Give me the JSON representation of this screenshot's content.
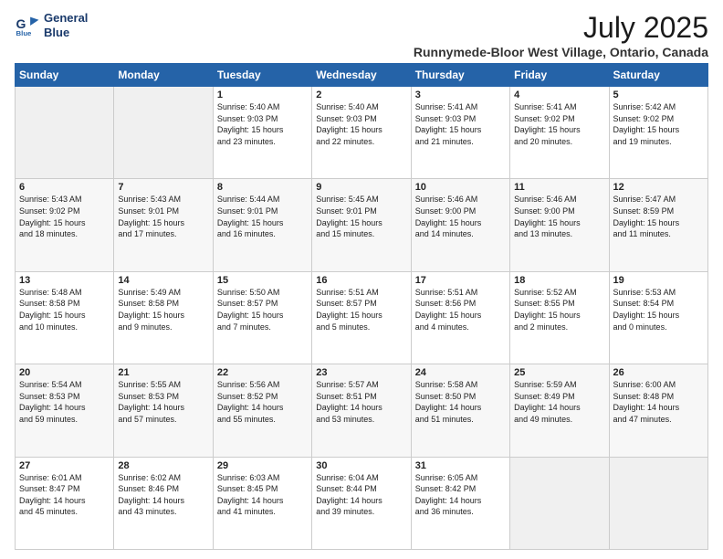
{
  "logo": {
    "line1": "General",
    "line2": "Blue"
  },
  "title": "July 2025",
  "location": "Runnymede-Bloor West Village, Ontario, Canada",
  "headers": [
    "Sunday",
    "Monday",
    "Tuesday",
    "Wednesday",
    "Thursday",
    "Friday",
    "Saturday"
  ],
  "weeks": [
    [
      {
        "day": "",
        "info": ""
      },
      {
        "day": "",
        "info": ""
      },
      {
        "day": "1",
        "info": "Sunrise: 5:40 AM\nSunset: 9:03 PM\nDaylight: 15 hours\nand 23 minutes."
      },
      {
        "day": "2",
        "info": "Sunrise: 5:40 AM\nSunset: 9:03 PM\nDaylight: 15 hours\nand 22 minutes."
      },
      {
        "day": "3",
        "info": "Sunrise: 5:41 AM\nSunset: 9:03 PM\nDaylight: 15 hours\nand 21 minutes."
      },
      {
        "day": "4",
        "info": "Sunrise: 5:41 AM\nSunset: 9:02 PM\nDaylight: 15 hours\nand 20 minutes."
      },
      {
        "day": "5",
        "info": "Sunrise: 5:42 AM\nSunset: 9:02 PM\nDaylight: 15 hours\nand 19 minutes."
      }
    ],
    [
      {
        "day": "6",
        "info": "Sunrise: 5:43 AM\nSunset: 9:02 PM\nDaylight: 15 hours\nand 18 minutes."
      },
      {
        "day": "7",
        "info": "Sunrise: 5:43 AM\nSunset: 9:01 PM\nDaylight: 15 hours\nand 17 minutes."
      },
      {
        "day": "8",
        "info": "Sunrise: 5:44 AM\nSunset: 9:01 PM\nDaylight: 15 hours\nand 16 minutes."
      },
      {
        "day": "9",
        "info": "Sunrise: 5:45 AM\nSunset: 9:01 PM\nDaylight: 15 hours\nand 15 minutes."
      },
      {
        "day": "10",
        "info": "Sunrise: 5:46 AM\nSunset: 9:00 PM\nDaylight: 15 hours\nand 14 minutes."
      },
      {
        "day": "11",
        "info": "Sunrise: 5:46 AM\nSunset: 9:00 PM\nDaylight: 15 hours\nand 13 minutes."
      },
      {
        "day": "12",
        "info": "Sunrise: 5:47 AM\nSunset: 8:59 PM\nDaylight: 15 hours\nand 11 minutes."
      }
    ],
    [
      {
        "day": "13",
        "info": "Sunrise: 5:48 AM\nSunset: 8:58 PM\nDaylight: 15 hours\nand 10 minutes."
      },
      {
        "day": "14",
        "info": "Sunrise: 5:49 AM\nSunset: 8:58 PM\nDaylight: 15 hours\nand 9 minutes."
      },
      {
        "day": "15",
        "info": "Sunrise: 5:50 AM\nSunset: 8:57 PM\nDaylight: 15 hours\nand 7 minutes."
      },
      {
        "day": "16",
        "info": "Sunrise: 5:51 AM\nSunset: 8:57 PM\nDaylight: 15 hours\nand 5 minutes."
      },
      {
        "day": "17",
        "info": "Sunrise: 5:51 AM\nSunset: 8:56 PM\nDaylight: 15 hours\nand 4 minutes."
      },
      {
        "day": "18",
        "info": "Sunrise: 5:52 AM\nSunset: 8:55 PM\nDaylight: 15 hours\nand 2 minutes."
      },
      {
        "day": "19",
        "info": "Sunrise: 5:53 AM\nSunset: 8:54 PM\nDaylight: 15 hours\nand 0 minutes."
      }
    ],
    [
      {
        "day": "20",
        "info": "Sunrise: 5:54 AM\nSunset: 8:53 PM\nDaylight: 14 hours\nand 59 minutes."
      },
      {
        "day": "21",
        "info": "Sunrise: 5:55 AM\nSunset: 8:53 PM\nDaylight: 14 hours\nand 57 minutes."
      },
      {
        "day": "22",
        "info": "Sunrise: 5:56 AM\nSunset: 8:52 PM\nDaylight: 14 hours\nand 55 minutes."
      },
      {
        "day": "23",
        "info": "Sunrise: 5:57 AM\nSunset: 8:51 PM\nDaylight: 14 hours\nand 53 minutes."
      },
      {
        "day": "24",
        "info": "Sunrise: 5:58 AM\nSunset: 8:50 PM\nDaylight: 14 hours\nand 51 minutes."
      },
      {
        "day": "25",
        "info": "Sunrise: 5:59 AM\nSunset: 8:49 PM\nDaylight: 14 hours\nand 49 minutes."
      },
      {
        "day": "26",
        "info": "Sunrise: 6:00 AM\nSunset: 8:48 PM\nDaylight: 14 hours\nand 47 minutes."
      }
    ],
    [
      {
        "day": "27",
        "info": "Sunrise: 6:01 AM\nSunset: 8:47 PM\nDaylight: 14 hours\nand 45 minutes."
      },
      {
        "day": "28",
        "info": "Sunrise: 6:02 AM\nSunset: 8:46 PM\nDaylight: 14 hours\nand 43 minutes."
      },
      {
        "day": "29",
        "info": "Sunrise: 6:03 AM\nSunset: 8:45 PM\nDaylight: 14 hours\nand 41 minutes."
      },
      {
        "day": "30",
        "info": "Sunrise: 6:04 AM\nSunset: 8:44 PM\nDaylight: 14 hours\nand 39 minutes."
      },
      {
        "day": "31",
        "info": "Sunrise: 6:05 AM\nSunset: 8:42 PM\nDaylight: 14 hours\nand 36 minutes."
      },
      {
        "day": "",
        "info": ""
      },
      {
        "day": "",
        "info": ""
      }
    ]
  ]
}
